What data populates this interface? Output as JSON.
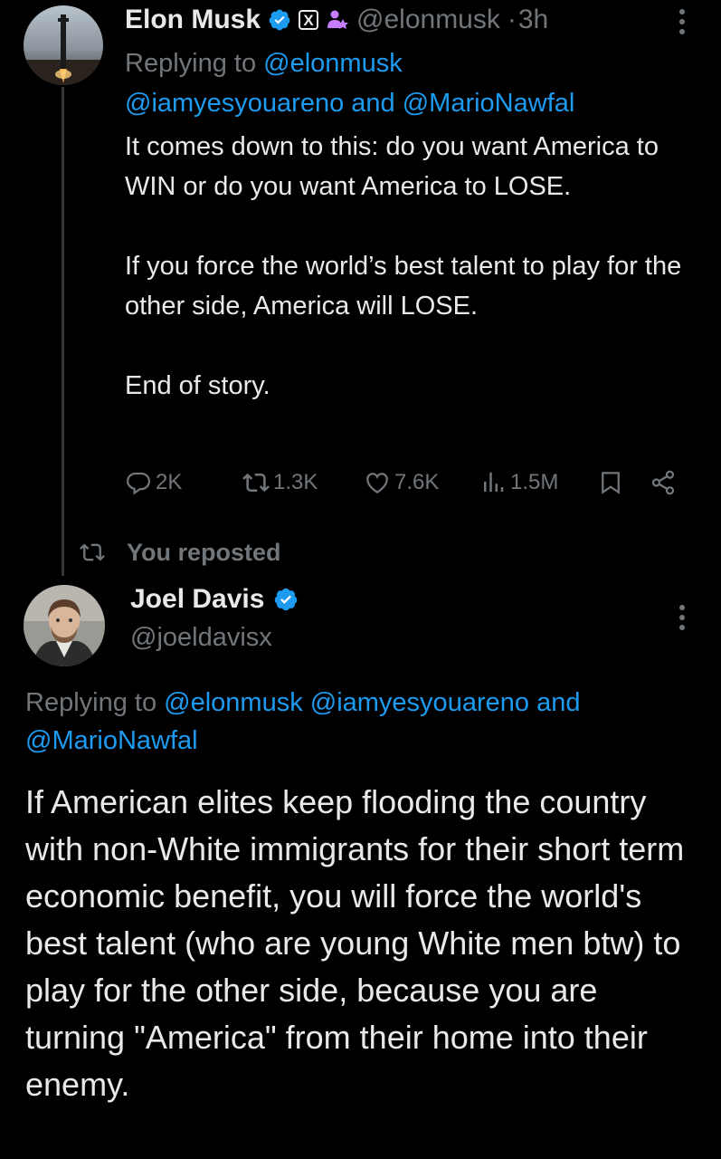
{
  "tweet1": {
    "name": "Elon Musk",
    "handle": "@elonmusk",
    "separator": "·",
    "time": "3h",
    "replying_prefix": "Replying to",
    "replying_handle": "@elonmusk",
    "mentions_line": "@iamyesyouareno and @MarioNawfal",
    "x_badge": "X",
    "body_lines_1": "It comes down to this: do you want America to WIN or do you want America to LOSE.",
    "body_lines_2": "If you force the world’s best talent to play for the other side, America will LOSE.",
    "body_lines_3": "End of story.",
    "stats": {
      "replies": "2K",
      "reposts": "1.3K",
      "likes": "7.6K",
      "views": "1.5M"
    },
    "icons": [
      "verified-badge-icon",
      "x-badge-icon",
      "affiliate-icon",
      "more-icon",
      "reply-icon",
      "repost-icon",
      "like-icon",
      "views-icon",
      "bookmark-icon",
      "share-icon"
    ]
  },
  "repost_label": "You reposted",
  "tweet2": {
    "name": "Joel Davis",
    "handle": "@joeldavisx",
    "replying_prefix": "Replying to",
    "replying_handles": "@elonmusk @iamyesyouareno",
    "replying_and": "and",
    "replying_last": "@MarioNawfal",
    "body": "If American elites keep flooding the country with non-White immigrants for their short term economic benefit, you will force the world's best talent (who are young White men btw) to play for the other side, because you are turning \"America\" from their home into their enemy."
  },
  "colors": {
    "background": "#000000",
    "text": "#e7e9ea",
    "muted": "#71767b",
    "link": "#1d9bf0",
    "verified": "#1d9bf0",
    "affiliate": "#c77dff"
  }
}
